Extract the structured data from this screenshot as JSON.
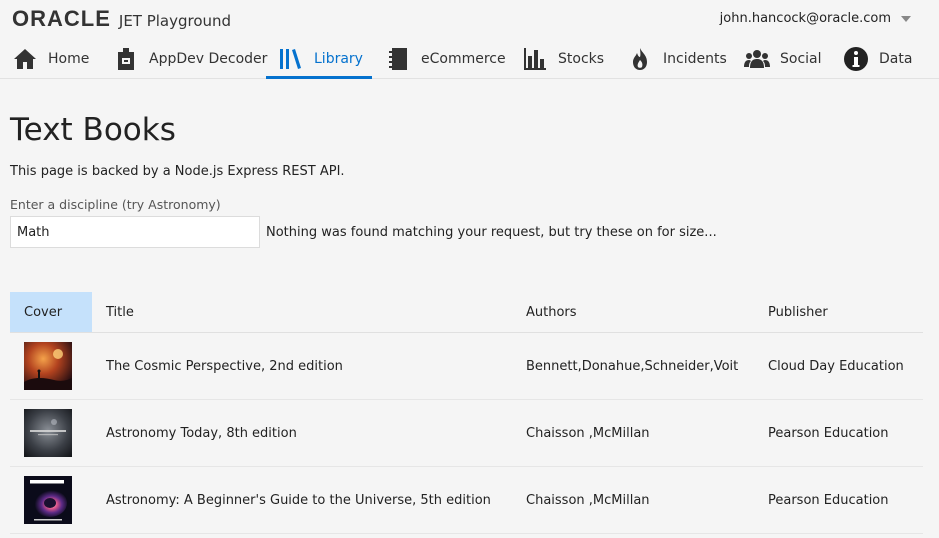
{
  "header": {
    "logo_text": "ORACLE",
    "app_title": "JET Playground",
    "user": "john.hancock@oracle.com"
  },
  "nav": [
    {
      "label": "Home",
      "icon": "home-icon"
    },
    {
      "label": "AppDev Decoder",
      "icon": "decoder-icon"
    },
    {
      "label": "Library",
      "icon": "library-icon",
      "selected": true
    },
    {
      "label": "eCommerce",
      "icon": "notebook-icon"
    },
    {
      "label": "Stocks",
      "icon": "bar-chart-icon"
    },
    {
      "label": "Incidents",
      "icon": "fire-icon"
    },
    {
      "label": "Social",
      "icon": "people-icon"
    },
    {
      "label": "Data",
      "icon": "info-icon"
    }
  ],
  "page": {
    "title": "Text Books",
    "description": "This page is backed by a Node.js Express REST API.",
    "search_label": "Enter a discipline (try Astronomy)",
    "search_value": "Math",
    "no_results_message": "Nothing was found matching your request, but try these on for size..."
  },
  "table": {
    "columns": [
      "Cover",
      "Title",
      "Authors",
      "Publisher"
    ],
    "rows": [
      {
        "title": "The Cosmic Perspective, 2nd edition",
        "authors": "Bennett,Donahue,Schneider,Voit",
        "publisher": "Cloud Day Education"
      },
      {
        "title": "Astronomy Today, 8th edition",
        "authors": "Chaisson ,McMillan",
        "publisher": "Pearson Education"
      },
      {
        "title": "Astronomy: A Beginner's Guide to the Universe, 5th edition",
        "authors": "Chaisson ,McMillan",
        "publisher": "Pearson Education"
      }
    ]
  },
  "colors": {
    "accent": "#0572ce",
    "sorted_header": "#c5e1fb",
    "background": "#f5f5f5"
  }
}
